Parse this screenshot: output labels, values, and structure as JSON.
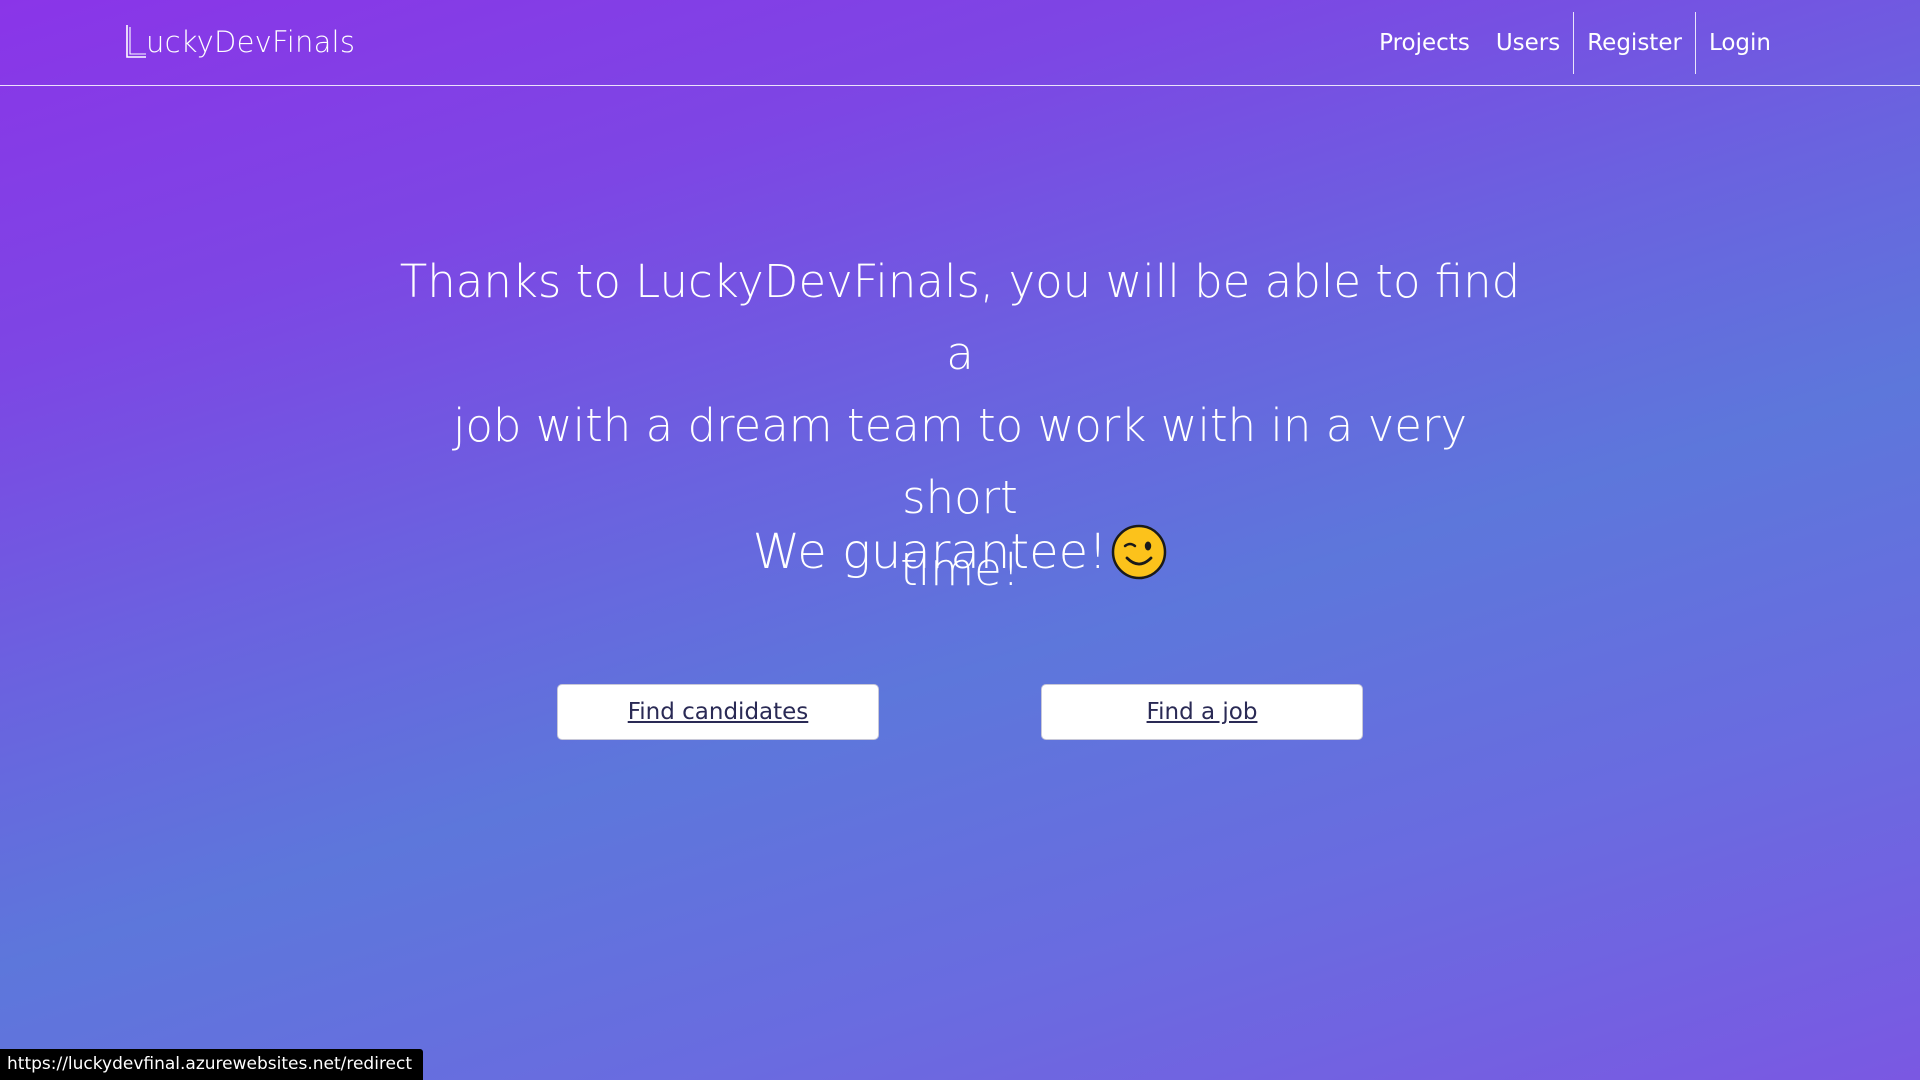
{
  "header": {
    "brand_letter": "L",
    "brand_name": "uckyDevFinals",
    "nav": {
      "projects": "Projects",
      "users": "Users",
      "register": "Register",
      "login": "Login"
    }
  },
  "hero": {
    "line1": "Thanks to LuckyDevFinals, you will be able to find a",
    "line2": "job with a dream team to work with in a very short",
    "line3": "time!",
    "guarantee": "We guarantee!",
    "guarantee_emoji": "winking-face-icon"
  },
  "actions": {
    "find_candidates": "Find candidates",
    "find_job": "Find a job"
  },
  "status_bar": {
    "url": "https://luckydevfinal.azurewebsites.net/redirect"
  },
  "colors": {
    "gradient_top": "#8a35e8",
    "gradient_mid": "#5d77db",
    "text": "#ffffff",
    "button_bg": "#ffffff",
    "button_text": "#2a2a55"
  }
}
